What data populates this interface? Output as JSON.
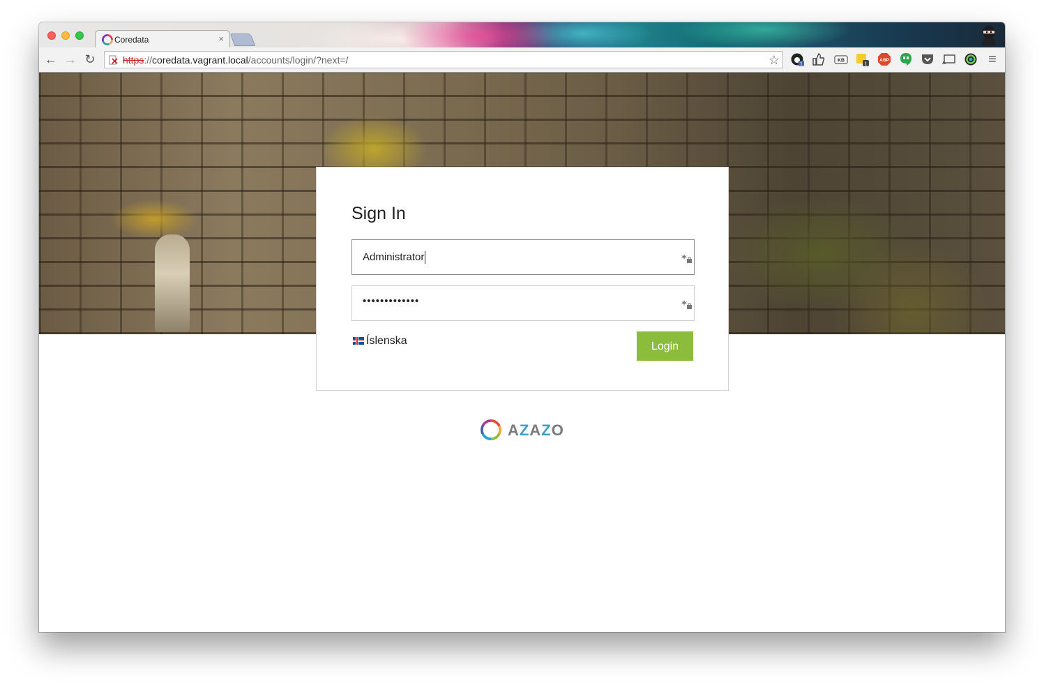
{
  "browser": {
    "tab": {
      "title": "Coredata",
      "close": "×"
    },
    "address": {
      "scheme": "https",
      "separator": "://",
      "host": "coredata.vagrant.local",
      "path": "/accounts/login/?next=/"
    },
    "nav": {
      "back": "←",
      "forward": "→",
      "reload": "↻"
    },
    "extensions": [
      "github-icon",
      "thumbs-up-icon",
      "kb-icon",
      "notes-icon",
      "adblock-icon",
      "hangouts-icon",
      "pocket-icon",
      "cast-icon",
      "color-picker-icon",
      "menu-icon"
    ],
    "extension_labels": {
      "kb": "KB",
      "abp": "ABP",
      "github_badge": "1",
      "notes_badge": "1",
      "menu": "≡"
    }
  },
  "login": {
    "title": "Sign In",
    "username_value": "Administrator",
    "password_value": "•••••••••••••",
    "language": "Íslenska",
    "submit": "Login"
  },
  "footer": {
    "brand_a1": "A",
    "brand_z1": "Z",
    "brand_a2": "A",
    "brand_z2": "Z",
    "brand_o": "O"
  },
  "colors": {
    "accent": "#8cbc3c",
    "brand_blue": "#3aa0c6"
  }
}
